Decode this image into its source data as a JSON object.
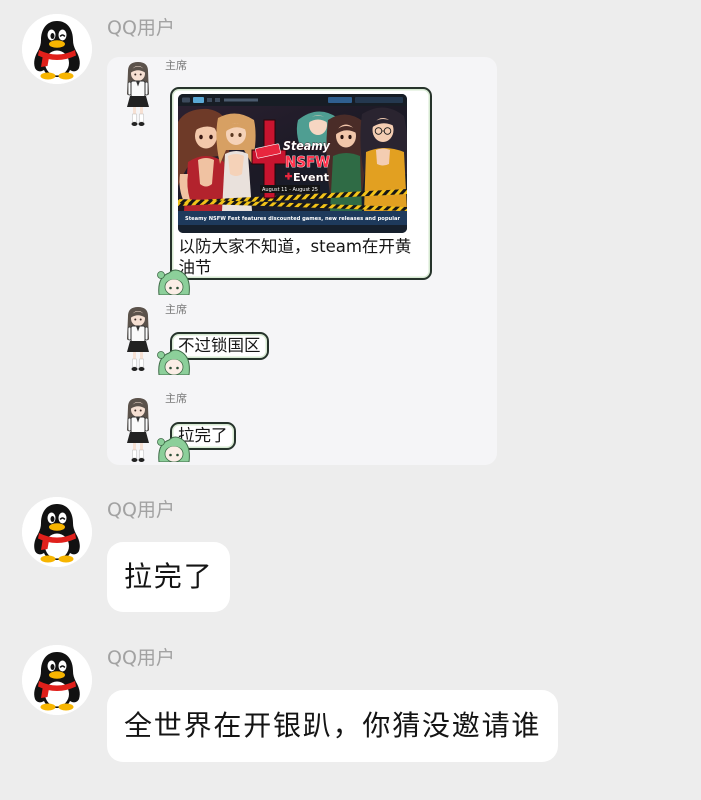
{
  "colors": {
    "page_bg": "#ededed",
    "bubble_bg": "#ffffff",
    "name_text": "#a2a2a2",
    "message_text": "#141414",
    "card_bg": "#f5f5f7",
    "sub_bubble_border": "#26332b"
  },
  "messages": [
    {
      "sender": "QQ用户",
      "avatar_icon": "qq-penguin-icon",
      "forwarded_image": {
        "sub_messages": [
          {
            "sender": "主席",
            "avatar_icon": "anime-girl-avatar-icon",
            "sticker_icon": "green-chibi-sticker-icon",
            "steam_screenshot": {
              "logo": {
                "line1": "Steamy",
                "line2": "NSFW",
                "line3": "Event"
              },
              "dates": "August 11 - August 25",
              "caption": "Steamy NSFW Fest features discounted games, new releases and popular"
            },
            "text": "以防大家不知道，steam在开黄油节"
          },
          {
            "sender": "主席",
            "avatar_icon": "anime-girl-avatar-icon",
            "sticker_icon": "green-chibi-sticker-icon",
            "text": "不过锁国区"
          },
          {
            "sender": "主席",
            "avatar_icon": "anime-girl-avatar-icon",
            "sticker_icon": "green-chibi-sticker-icon",
            "text": "拉完了"
          }
        ]
      }
    },
    {
      "sender": "QQ用户",
      "avatar_icon": "qq-penguin-icon",
      "text": "拉完了"
    },
    {
      "sender": "QQ用户",
      "avatar_icon": "qq-penguin-icon",
      "text": "全世界在开银趴，你猜没邀请谁"
    }
  ]
}
